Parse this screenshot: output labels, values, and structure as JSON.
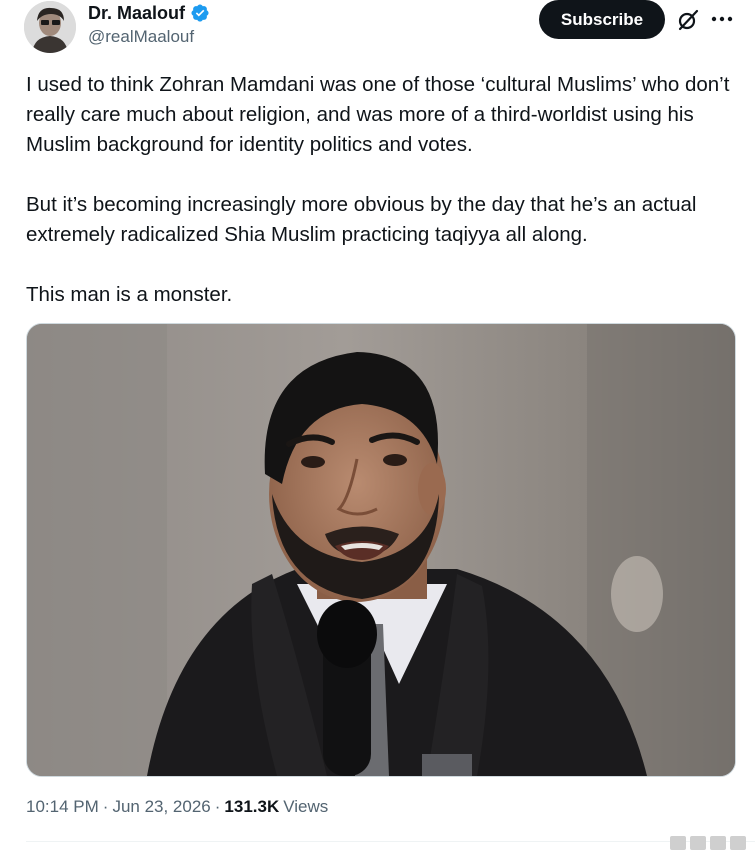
{
  "author": {
    "display_name": "Dr. Maalouf",
    "handle": "@realMaalouf",
    "avatar_icon": "avatar-photo",
    "verified_icon": "verified-badge-icon",
    "verified_color": "#1d9bf0"
  },
  "actions": {
    "subscribe_label": "Subscribe",
    "grok_icon": "grok-icon",
    "more_icon": "more-icon"
  },
  "tweet": {
    "paragraphs": [
      "I used to think Zohran Mamdani was one of those ‘cultural Muslims’ who don’t really care much about religion, and was more of a third-worldist using his Muslim background for identity politics and votes.",
      "But it’s becoming increasingly more obvious by the day that he’s an actual extremely radicalized Shia Muslim practicing taqiyya all along.",
      "This man is a monster."
    ],
    "media_icon": "photo"
  },
  "meta": {
    "time": "10:14 PM",
    "date": "Jun 23, 2026",
    "separator": "·",
    "views_count": "131.3K",
    "views_label": "Views"
  }
}
